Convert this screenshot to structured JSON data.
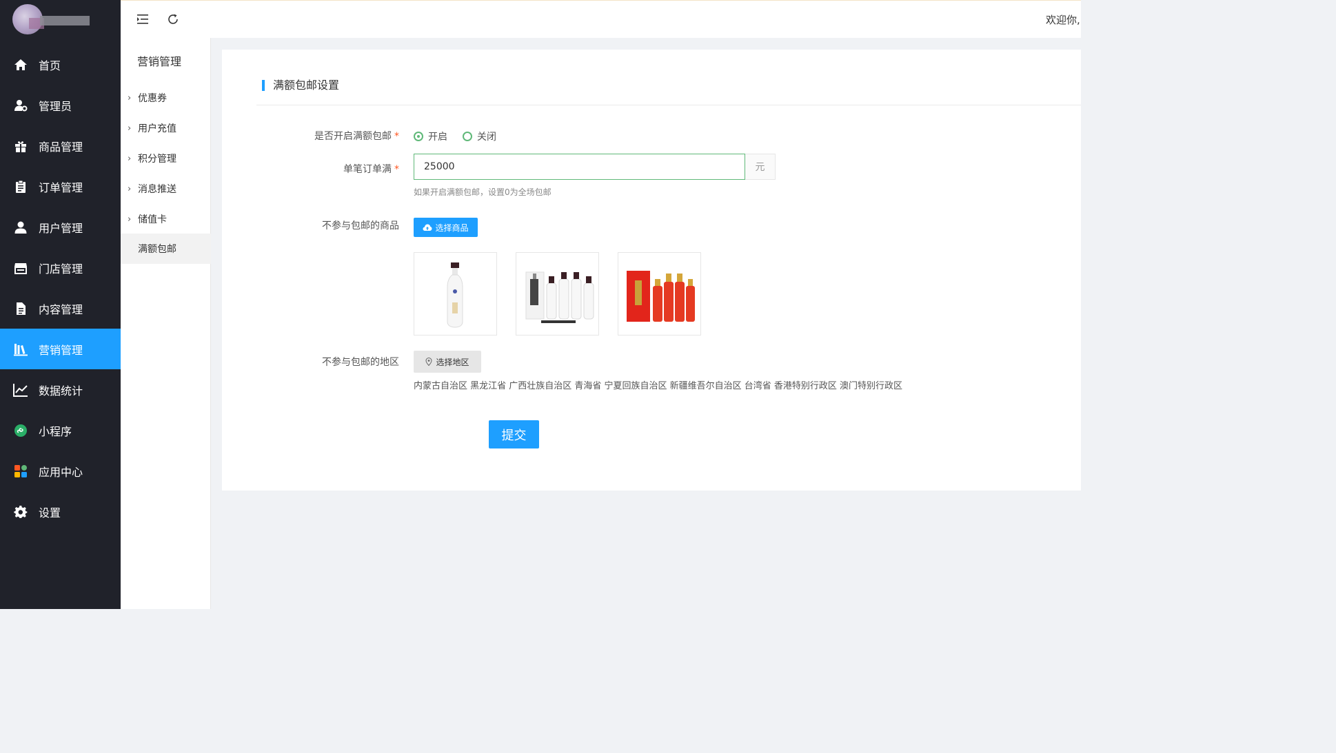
{
  "sidebar": {
    "items": [
      {
        "label": "首页",
        "icon": "home-icon"
      },
      {
        "label": "管理员",
        "icon": "admin-user-icon"
      },
      {
        "label": "商品管理",
        "icon": "gift-icon"
      },
      {
        "label": "订单管理",
        "icon": "clipboard-icon"
      },
      {
        "label": "用户管理",
        "icon": "user-icon"
      },
      {
        "label": "门店管理",
        "icon": "store-icon"
      },
      {
        "label": "内容管理",
        "icon": "document-icon"
      },
      {
        "label": "营销管理",
        "icon": "books-icon",
        "active": true
      },
      {
        "label": "数据统计",
        "icon": "line-chart-icon"
      },
      {
        "label": "小程序",
        "icon": "mini-program-icon"
      },
      {
        "label": "应用中心",
        "icon": "app-grid-icon"
      },
      {
        "label": "设置",
        "icon": "gear-icon"
      }
    ]
  },
  "topbar": {
    "welcome": "欢迎你,"
  },
  "subnav": {
    "title": "营销管理",
    "items": [
      {
        "label": "优惠券"
      },
      {
        "label": "用户充值"
      },
      {
        "label": "积分管理"
      },
      {
        "label": "消息推送"
      },
      {
        "label": "储值卡"
      },
      {
        "label": "满额包邮",
        "active": true
      }
    ]
  },
  "form": {
    "section_title": "满额包邮设置",
    "enable_label": "是否开启满额包邮",
    "required_mark": "*",
    "radio_on": "开启",
    "radio_off": "关闭",
    "radio_selected": "开启",
    "threshold_label": "单笔订单满",
    "threshold_value": "25000",
    "threshold_suffix": "元",
    "threshold_hint": "如果开启满额包邮，设置0为全场包邮",
    "excluded_goods_label": "不参与包邮的商品",
    "select_goods_button": "选择商品",
    "excluded_region_label": "不参与包邮的地区",
    "select_region_button": "选择地区",
    "regions": "内蒙古自治区 黑龙江省 广西壮族自治区 青海省 宁夏回族自治区 新疆维吾尔自治区 台湾省 香港特别行政区 澳门特别行政区",
    "submit": "提交"
  },
  "colors": {
    "sidebar_bg": "#20222a",
    "accent_blue": "#1e9fff",
    "radio_green": "#5fb878",
    "required_red": "#ff5722"
  }
}
